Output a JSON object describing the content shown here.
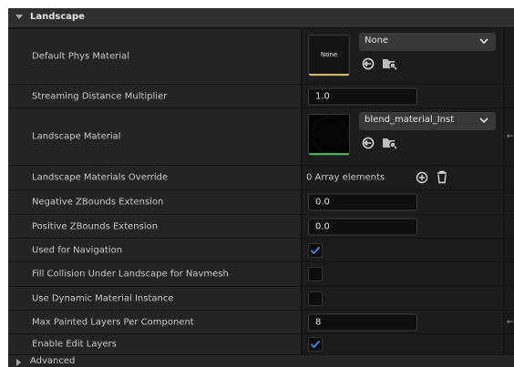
{
  "section": {
    "title": "Landscape",
    "icon": "triangle-down-icon"
  },
  "rows": {
    "default_phys_material": {
      "label": "Default Phys Material",
      "thumb_text": "None",
      "combo_value": "None"
    },
    "streaming_distance": {
      "label": "Streaming Distance Multiplier",
      "value": "1.0"
    },
    "landscape_material": {
      "label": "Landscape Material",
      "combo_value": "blend_material_Inst"
    },
    "materials_override": {
      "label": "Landscape Materials Override",
      "value": "0 Array elements"
    },
    "neg_zbounds": {
      "label": "Negative ZBounds Extension",
      "value": "0.0"
    },
    "pos_zbounds": {
      "label": "Positive ZBounds Extension",
      "value": "0.0"
    },
    "used_for_navigation": {
      "label": "Used for Navigation",
      "checked": true
    },
    "fill_collision": {
      "label": "Fill Collision Under Landscape for Navmesh",
      "checked": false
    },
    "dynamic_material": {
      "label": "Use Dynamic Material Instance",
      "checked": false
    },
    "max_painted_layers": {
      "label": "Max Painted Layers Per Component",
      "value": "8"
    },
    "enable_edit_layers": {
      "label": "Enable Edit Layers",
      "checked": true
    }
  },
  "advanced": {
    "label": "Advanced"
  },
  "colors": {
    "accent_check": "#3c8ce6",
    "none_underline": "#c9b86a",
    "material_underline": "#3bb94a"
  }
}
